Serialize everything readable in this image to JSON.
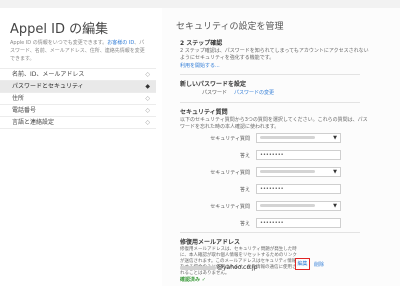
{
  "sidebar": {
    "title": "Appel ID の編集",
    "desc_prefix": "Apple ID の情報をいつでも変更できます。",
    "desc_link": "お客様の ID",
    "desc_rest": "、パスワード、名前、メールアドレス、住所、連絡先情報を変更できます。",
    "items": [
      {
        "label": "名前、ID、メールアドレス"
      },
      {
        "label": "パスワードとセキュリティ"
      },
      {
        "label": "住所"
      },
      {
        "label": "電話番号"
      },
      {
        "label": "言語と連絡設定"
      }
    ],
    "active_index": 1
  },
  "main": {
    "title": "セキュリティの設定を管理",
    "two_step": {
      "heading": "2 ステップ確認",
      "text": "2 ステップ確認は、パスワードを知られてしまってもアカウントにアクセスされないようにセキュリティを強化する機能です。",
      "link": "利用を開始する..."
    },
    "new_password": {
      "heading": "新しいパスワードを設定",
      "label": "パスワード",
      "link": "パスワードの変更"
    },
    "questions": {
      "heading": "セキュリティ質問",
      "text": "以下のセキュリティ質問から3つの質問を選択してください。これらの質問は、パスワードを忘れた時の本人確認に使われます。",
      "rows": [
        {
          "q_label": "セキュリティ質問",
          "a_label": "答え",
          "answer": "••••••••"
        },
        {
          "q_label": "セキュリティ質問",
          "a_label": "答え",
          "answer": "••••••••"
        },
        {
          "q_label": "セキュリティ質問",
          "a_label": "答え",
          "answer": "••••••••"
        }
      ]
    },
    "rescue": {
      "heading": "修復用メールアドレス",
      "text": "修復用メールアドレスは、セキュリティ問題が発生した時に、本人確認が取れ個人情報をリセットするためのリンクが送信されます。このメールアドレスはセキュリティ情報をする場合のみに使用されます。他の情報の通信に使用されることはありません。",
      "email_domain": "@yahoo.co.jp",
      "status": "確認済み ✓",
      "edit": "編集",
      "delete": "削除"
    }
  },
  "icons": {
    "chevron": "chevron-right-icon",
    "caret": "caret-down-icon"
  }
}
